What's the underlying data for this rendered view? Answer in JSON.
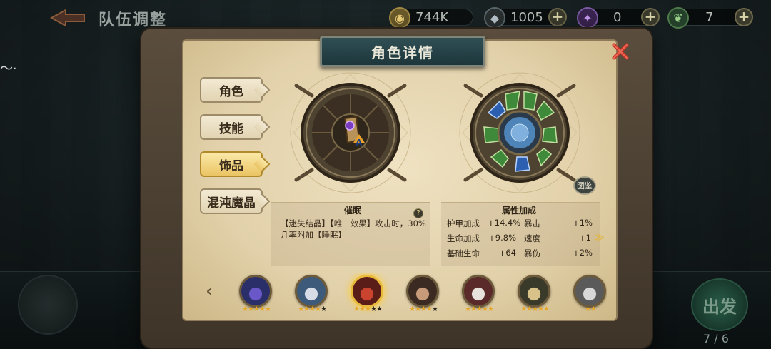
{
  "top": {
    "title": "队伍调整",
    "gold": "744K",
    "gems": "1005",
    "crystal": "0",
    "stamina": "7"
  },
  "panel": {
    "title": "角色详情",
    "tabs": [
      "角色",
      "技能",
      "饰品",
      "混沌魔晶"
    ],
    "active_tab": 2,
    "gallery_label": "图鉴"
  },
  "accessory": {
    "name": "催眠",
    "description": "【迷失结晶】【唯一效果】攻击时，30%几率附加【睡眠】",
    "help": "?"
  },
  "attributes": {
    "title": "属性加成",
    "rows": [
      {
        "label": "护甲加成",
        "value": "+14.4%"
      },
      {
        "label": "暴击",
        "value": "+1%"
      },
      {
        "label": "生命加成",
        "value": "+9.8%"
      },
      {
        "label": "速度",
        "value": "+1"
      },
      {
        "label": "基础生命",
        "value": "+64"
      },
      {
        "label": "暴伤",
        "value": "+2%"
      }
    ]
  },
  "heroes": [
    {
      "name": "witch",
      "stars": 5,
      "max": 5,
      "selected": false
    },
    {
      "name": "scholar",
      "stars": 4,
      "max": 5,
      "selected": false
    },
    {
      "name": "red-hood",
      "stars": 3,
      "max": 5,
      "selected": true
    },
    {
      "name": "gentleman",
      "stars": 4,
      "max": 5,
      "selected": false
    },
    {
      "name": "jester",
      "stars": 5,
      "max": 5,
      "selected": false
    },
    {
      "name": "angel",
      "stars": 5,
      "max": 5,
      "selected": false
    },
    {
      "name": "partial",
      "stars": 2,
      "max": 2,
      "selected": false
    }
  ],
  "start": {
    "label": "出发",
    "count": "7 / 6"
  },
  "colors": {
    "accent_gold": "#e8b93a",
    "banner": "#2f4f55",
    "star_on": "#e6a82a",
    "star_off": "#2a2620"
  }
}
